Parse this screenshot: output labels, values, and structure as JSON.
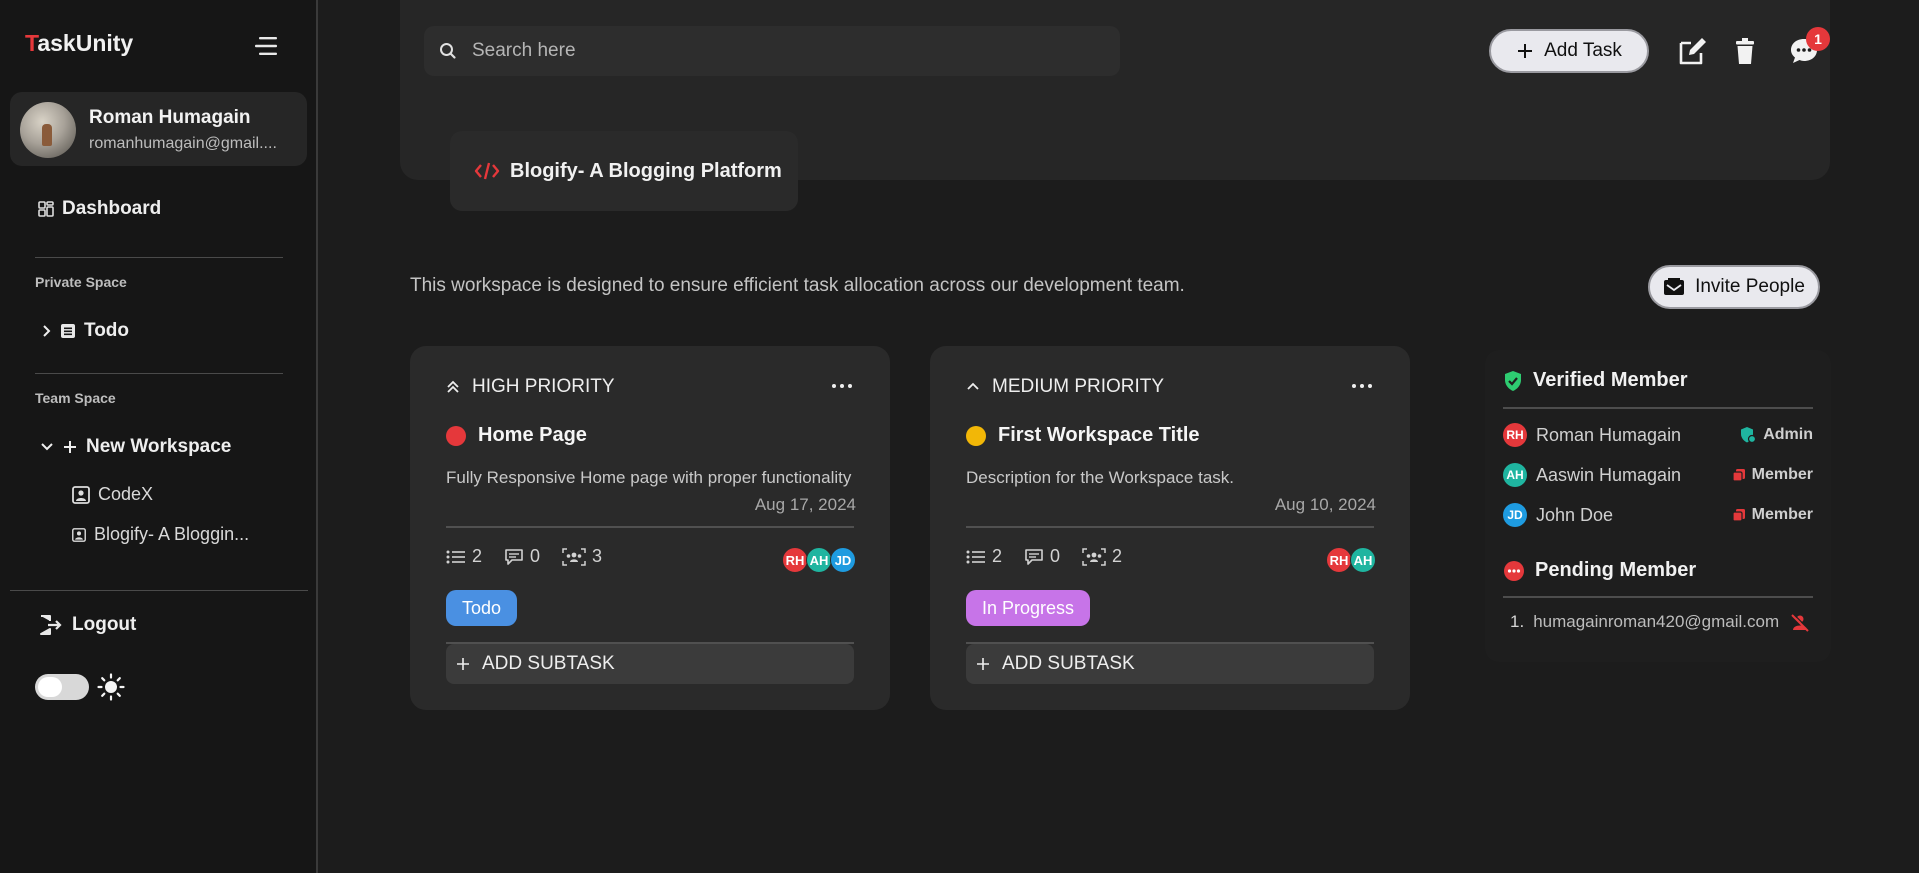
{
  "brand": {
    "initial": "T",
    "rest": "askUnity"
  },
  "user": {
    "name": "Roman Humagain",
    "email": "romanhumagain@gmail...."
  },
  "nav": {
    "dashboard": "Dashboard",
    "logout": "Logout"
  },
  "private_space": {
    "label": "Private Space",
    "items": [
      {
        "label": "Todo"
      }
    ]
  },
  "team_space": {
    "label": "Team Space",
    "new_workspace": "New Workspace",
    "workspaces": [
      {
        "label": "CodeX"
      },
      {
        "label": "Blogify- A Bloggin..."
      }
    ]
  },
  "header": {
    "search_placeholder": "Search here",
    "add_task": "Add Task",
    "notification_count": "1"
  },
  "workspace": {
    "title": "Blogify- A Blogging Platform",
    "description": "This workspace is designed to ensure efficient task allocation across our development team.",
    "invite": "Invite People"
  },
  "cards": [
    {
      "priority": "HIGH PRIORITY",
      "title": "Home Page",
      "dot_color": "#e5383b",
      "description": "Fully Responsive Home page with proper functionality",
      "date": "Aug 17, 2024",
      "subtasks": "2",
      "comments": "0",
      "members": "3",
      "avatars": [
        {
          "initials": "RH",
          "color": "#e5383b"
        },
        {
          "initials": "AH",
          "color": "#1fb5a0"
        },
        {
          "initials": "JD",
          "color": "#1e9be0"
        }
      ],
      "status": "Todo",
      "status_color": "#4a90e2",
      "add_subtask": "ADD SUBTASK"
    },
    {
      "priority": "MEDIUM PRIORITY",
      "title": "First Workspace Title",
      "dot_color": "#f2b707",
      "description": "Description for the Workspace task.",
      "date": "Aug 10, 2024",
      "subtasks": "2",
      "comments": "0",
      "members": "2",
      "avatars": [
        {
          "initials": "RH",
          "color": "#e5383b"
        },
        {
          "initials": "AH",
          "color": "#1fb5a0"
        }
      ],
      "status": "In Progress",
      "status_color": "#c774e8",
      "add_subtask": "ADD SUBTASK"
    }
  ],
  "members_panel": {
    "verified_title": "Verified Member",
    "verified": [
      {
        "initials": "RH",
        "name": "Roman Humagain",
        "role": "Admin",
        "color": "#e5383b"
      },
      {
        "initials": "AH",
        "name": "Aaswin Humagain",
        "role": "Member",
        "color": "#1fb5a0"
      },
      {
        "initials": "JD",
        "name": "John Doe",
        "role": "Member",
        "color": "#1e9be0"
      }
    ],
    "pending_title": "Pending Member",
    "pending": [
      {
        "index": "1.",
        "email": "humagainroman420@gmail.com"
      }
    ]
  },
  "colors": {
    "accent": "#e5383b",
    "verified": "#2ecc71",
    "admin_icon": "#1fb5a0",
    "member_icon": "#e5383b"
  }
}
